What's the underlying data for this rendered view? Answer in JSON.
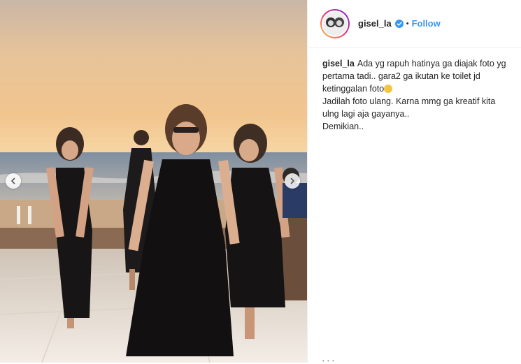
{
  "post": {
    "username": "gisel_la",
    "follow_label": "Follow",
    "separator": "•",
    "caption": {
      "username": "gisel_la",
      "line1": "Ada yg rapuh hatinya ga diajak foto yg pertama tadi.. gara2 ga ikutan ke toilet jd ketinggalan foto",
      "line2": "Jadilah foto ulang. Karna mmg ga kreatif kita ulng lagi aja gayanya..",
      "line3": "Demikian.."
    },
    "more_dots": "• • •"
  },
  "icons": {
    "prev": "chevron-left-icon",
    "next": "chevron-right-icon",
    "verified": "verified-badge-icon",
    "emoji": "rolling-laughing-emoji"
  },
  "colors": {
    "follow": "#3897f0",
    "verified": "#3897f0",
    "text": "#262626"
  }
}
